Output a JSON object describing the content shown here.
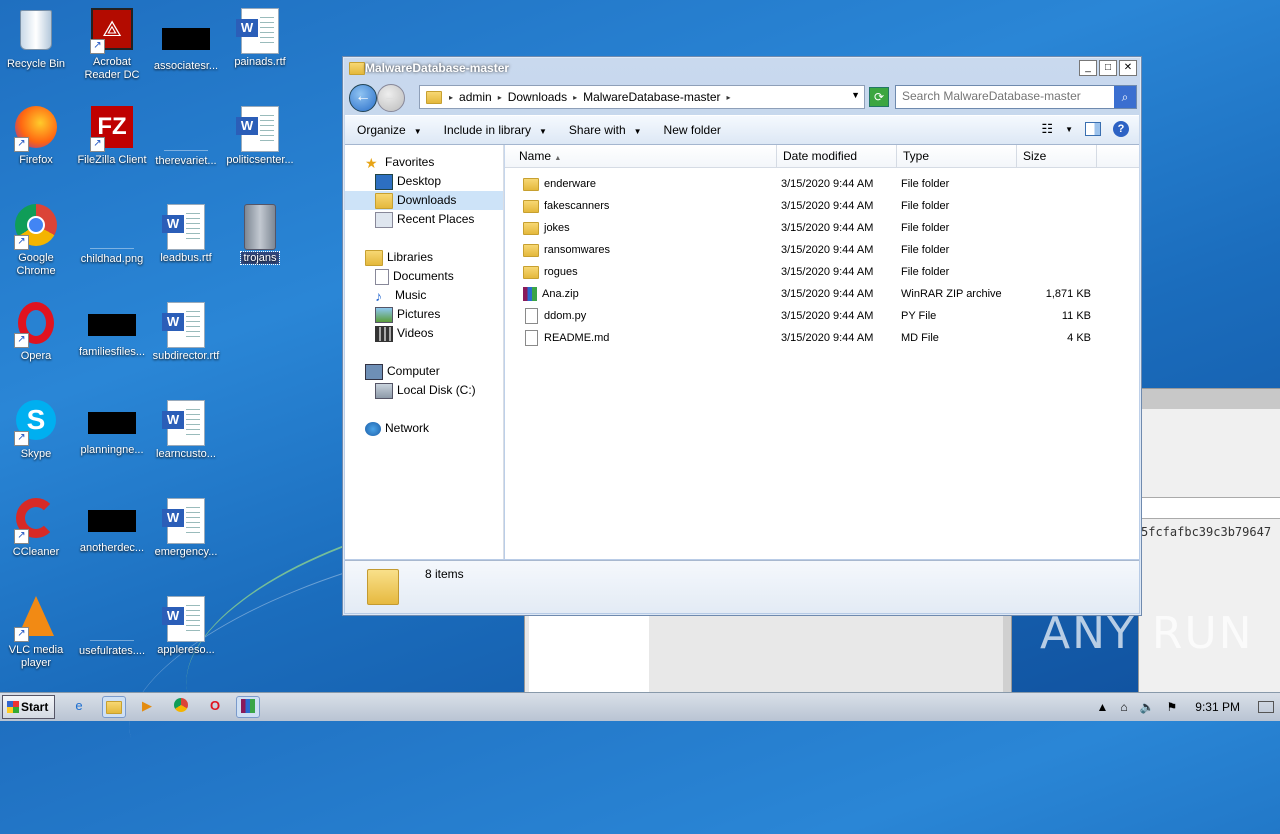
{
  "desktop": {
    "icons": [
      {
        "label": "Recycle Bin"
      },
      {
        "label": "Acrobat Reader DC"
      },
      {
        "label": "associatesr..."
      },
      {
        "label": "painads.rtf"
      },
      {
        "label": "Firefox"
      },
      {
        "label": "FileZilla Client"
      },
      {
        "label": "therevariet..."
      },
      {
        "label": "politicsenter..."
      },
      {
        "label": "Google Chrome"
      },
      {
        "label": "childhad.png"
      },
      {
        "label": "leadbus.rtf"
      },
      {
        "label": "trojans"
      },
      {
        "label": "Opera"
      },
      {
        "label": "familiesfiles..."
      },
      {
        "label": "subdirector.rtf"
      },
      {
        "label": "Skype"
      },
      {
        "label": "planningne..."
      },
      {
        "label": "learncusto..."
      },
      {
        "label": "CCleaner"
      },
      {
        "label": "anotherdec..."
      },
      {
        "label": "emergency..."
      },
      {
        "label": "VLC media player"
      },
      {
        "label": "usefulrates...."
      },
      {
        "label": "applereso..."
      }
    ]
  },
  "window": {
    "title": "MalwareDatabase-master",
    "breadcrumb": [
      "admin",
      "Downloads",
      "MalwareDatabase-master"
    ],
    "search_placeholder": "Search MalwareDatabase-master",
    "toolbar": {
      "organize": "Organize",
      "include": "Include in library",
      "share": "Share with",
      "newfolder": "New folder"
    },
    "nav": {
      "favorites": "Favorites",
      "desktop": "Desktop",
      "downloads": "Downloads",
      "recent": "Recent Places",
      "libraries": "Libraries",
      "documents": "Documents",
      "music": "Music",
      "pictures": "Pictures",
      "videos": "Videos",
      "computer": "Computer",
      "localdisk": "Local Disk (C:)",
      "network": "Network"
    },
    "columns": {
      "name": "Name",
      "date": "Date modified",
      "type": "Type",
      "size": "Size"
    },
    "files": [
      {
        "name": "enderware",
        "date": "3/15/2020 9:44 AM",
        "type": "File folder",
        "size": ""
      },
      {
        "name": "fakescanners",
        "date": "3/15/2020 9:44 AM",
        "type": "File folder",
        "size": ""
      },
      {
        "name": "jokes",
        "date": "3/15/2020 9:44 AM",
        "type": "File folder",
        "size": ""
      },
      {
        "name": "ransomwares",
        "date": "3/15/2020 9:44 AM",
        "type": "File folder",
        "size": ""
      },
      {
        "name": "rogues",
        "date": "3/15/2020 9:44 AM",
        "type": "File folder",
        "size": ""
      },
      {
        "name": "Ana.zip",
        "date": "3/15/2020 9:44 AM",
        "type": "WinRAR ZIP archive",
        "size": "1,871 KB"
      },
      {
        "name": "ddom.py",
        "date": "3/15/2020 9:44 AM",
        "type": "PY File",
        "size": "11 KB"
      },
      {
        "name": "README.md",
        "date": "3/15/2020 9:44 AM",
        "type": "MD File",
        "size": "4 KB"
      }
    ],
    "status": "8 items"
  },
  "background": {
    "hash_text": "5fcfafbc39c3b79647"
  },
  "taskbar": {
    "start": "Start",
    "clock": "9:31 PM"
  },
  "watermark": "ANY RUN"
}
